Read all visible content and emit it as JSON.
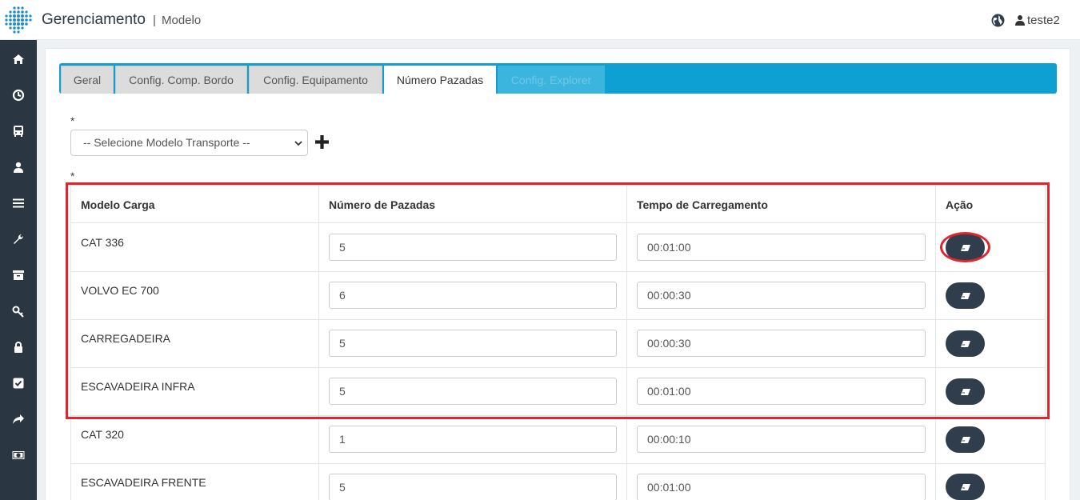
{
  "header": {
    "title": "Gerenciamento",
    "separator": "|",
    "subtitle": "Modelo",
    "user": "teste2"
  },
  "sidebar": {
    "items": [
      {
        "icon": "home-icon"
      },
      {
        "icon": "dashboard-icon"
      },
      {
        "icon": "bus-icon"
      },
      {
        "icon": "user-icon"
      },
      {
        "icon": "menu-icon"
      },
      {
        "icon": "wrench-icon"
      },
      {
        "icon": "archive-icon"
      },
      {
        "icon": "key-icon"
      },
      {
        "icon": "lock-icon"
      },
      {
        "icon": "checkbox-icon"
      },
      {
        "icon": "share-icon"
      },
      {
        "icon": "money-icon"
      }
    ]
  },
  "tabs": [
    {
      "label": "Geral",
      "state": "normal"
    },
    {
      "label": "Config. Comp. Bordo",
      "state": "normal"
    },
    {
      "label": "Config. Equipamento",
      "state": "normal"
    },
    {
      "label": "Número Pazadas",
      "state": "active"
    },
    {
      "label": "Config. Explorer",
      "state": "disabled"
    }
  ],
  "form": {
    "required_mark": "*",
    "select_value": "-- Selecione Modelo Transporte --"
  },
  "table": {
    "headers": [
      "Modelo Carga",
      "Número de Pazadas",
      "Tempo de Carregamento",
      "Ação"
    ],
    "rows": [
      {
        "model": "CAT 336",
        "pazadas": "5",
        "tempo": "00:01:00"
      },
      {
        "model": "VOLVO EC 700",
        "pazadas": "6",
        "tempo": "00:00:30"
      },
      {
        "model": "CARREGADEIRA",
        "pazadas": "5",
        "tempo": "00:00:30"
      },
      {
        "model": "ESCAVADEIRA INFRA",
        "pazadas": "5",
        "tempo": "00:01:00"
      },
      {
        "model": "CAT 320",
        "pazadas": "1",
        "tempo": "00:00:10"
      },
      {
        "model": "ESCAVADEIRA FRENTE",
        "pazadas": "5",
        "tempo": "00:01:00"
      }
    ]
  },
  "colors": {
    "sidebar": "#2b3643",
    "tab_bar": "#0e9fd3",
    "action_button": "#2f3d4c",
    "highlight": "#e3242b"
  }
}
